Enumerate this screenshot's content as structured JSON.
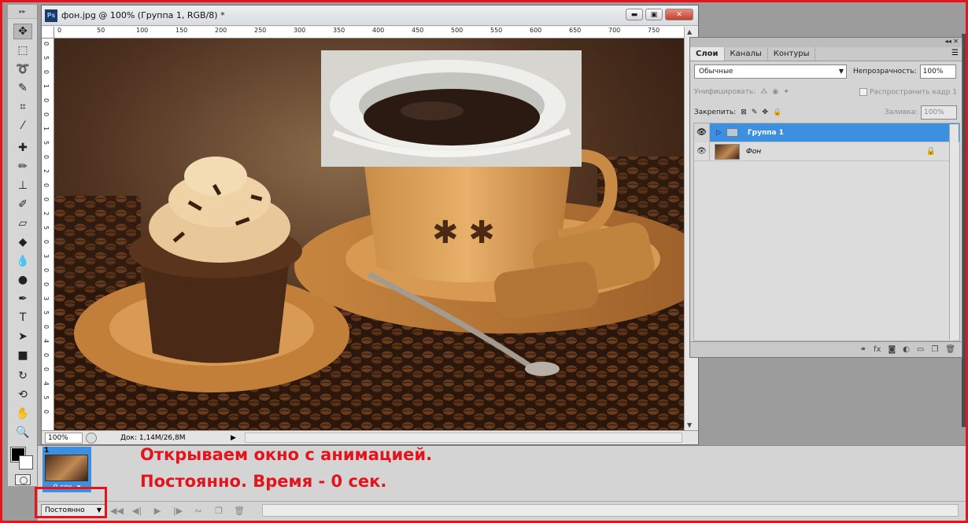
{
  "document": {
    "title": "фон.jpg @ 100% (Группа 1, RGB/8) *",
    "app_badge": "Ps",
    "zoom": "100%",
    "doc_size": "Док: 1,14M/26,8M",
    "ruler_top": [
      "0",
      "50",
      "100",
      "150",
      "200",
      "250",
      "300",
      "350",
      "400",
      "450",
      "500",
      "550",
      "600",
      "650",
      "700",
      "750"
    ],
    "ruler_left": [
      "0",
      "5",
      "0",
      "1",
      "0",
      "0",
      "1",
      "5",
      "0",
      "2",
      "0",
      "0",
      "2",
      "5",
      "0",
      "3",
      "0",
      "0",
      "3",
      "5",
      "0",
      "4",
      "0",
      "0",
      "4",
      "5",
      "0"
    ]
  },
  "layers_panel": {
    "tabs": [
      "Слои",
      "Каналы",
      "Контуры"
    ],
    "blend_mode": "Обычные",
    "opacity_label": "Непрозрачность:",
    "opacity_value": "100%",
    "unify_label": "Унифицировать:",
    "propagate_label": "Распространить кадр 1",
    "lock_label": "Закрепить:",
    "fill_label": "Заливка:",
    "fill_value": "100%",
    "layers": [
      {
        "name": "Группа 1",
        "type": "group",
        "selected": true
      },
      {
        "name": "Фон",
        "type": "background",
        "selected": false
      }
    ]
  },
  "animation": {
    "frame_number": "1",
    "frame_delay": "0 сек.",
    "loop": "Постоянно"
  },
  "annotations": {
    "line1": "Открываем окно с анимацией.",
    "line2": "Постоянно. Время - 0 сек."
  },
  "colors": {
    "annotation_red": "#e3141c",
    "selection_blue": "#3d8fe0"
  }
}
